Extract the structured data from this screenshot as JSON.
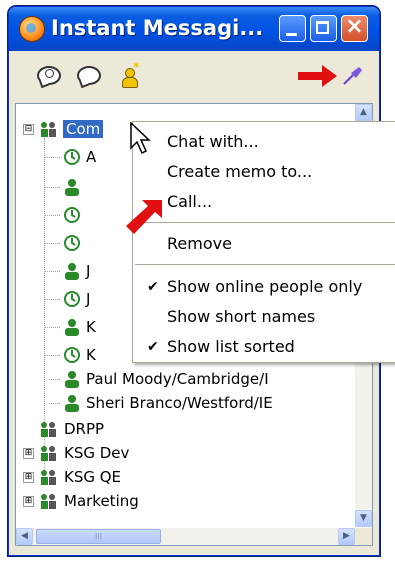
{
  "window": {
    "title": "Instant Messagi...",
    "title_bar_color": "#0052e6",
    "close_button_color": "#d4502a"
  },
  "toolbar": {
    "icons": [
      "chat-icon",
      "memo-icon",
      "add-person-icon",
      "pin-icon"
    ]
  },
  "contact_list": {
    "groups": [
      {
        "label": "Com",
        "expander": "⊟",
        "selected": true,
        "members": [
          "A",
          "",
          "",
          "",
          "J",
          "J",
          "K",
          "K",
          "Paul Moody/Cambridge/I",
          "Sheri Branco/Westford/IE"
        ]
      },
      {
        "label": "DRPP",
        "expander": ""
      },
      {
        "label": "KSG Dev",
        "expander": "⊞"
      },
      {
        "label": "KSG QE",
        "expander": "⊞"
      },
      {
        "label": "Marketing",
        "expander": "⊞"
      }
    ]
  },
  "context_menu": {
    "items": [
      {
        "label": "Chat with...",
        "checked": false
      },
      {
        "label": "Create memo to...",
        "checked": false
      },
      {
        "label": "Call...",
        "checked": false
      },
      {
        "label": "Remove",
        "checked": false
      },
      {
        "label": "Show online people only",
        "checked": true
      },
      {
        "label": "Show short names",
        "checked": false
      },
      {
        "label": "Show list sorted",
        "checked": true
      }
    ],
    "check_glyph": "✔"
  },
  "scrollbar": {
    "up": "▲",
    "down": "▼",
    "left": "◀",
    "right": "▶",
    "grip": "III"
  },
  "accent_colors": {
    "selection": "#316ac5",
    "red_arrow": "#e01010"
  }
}
